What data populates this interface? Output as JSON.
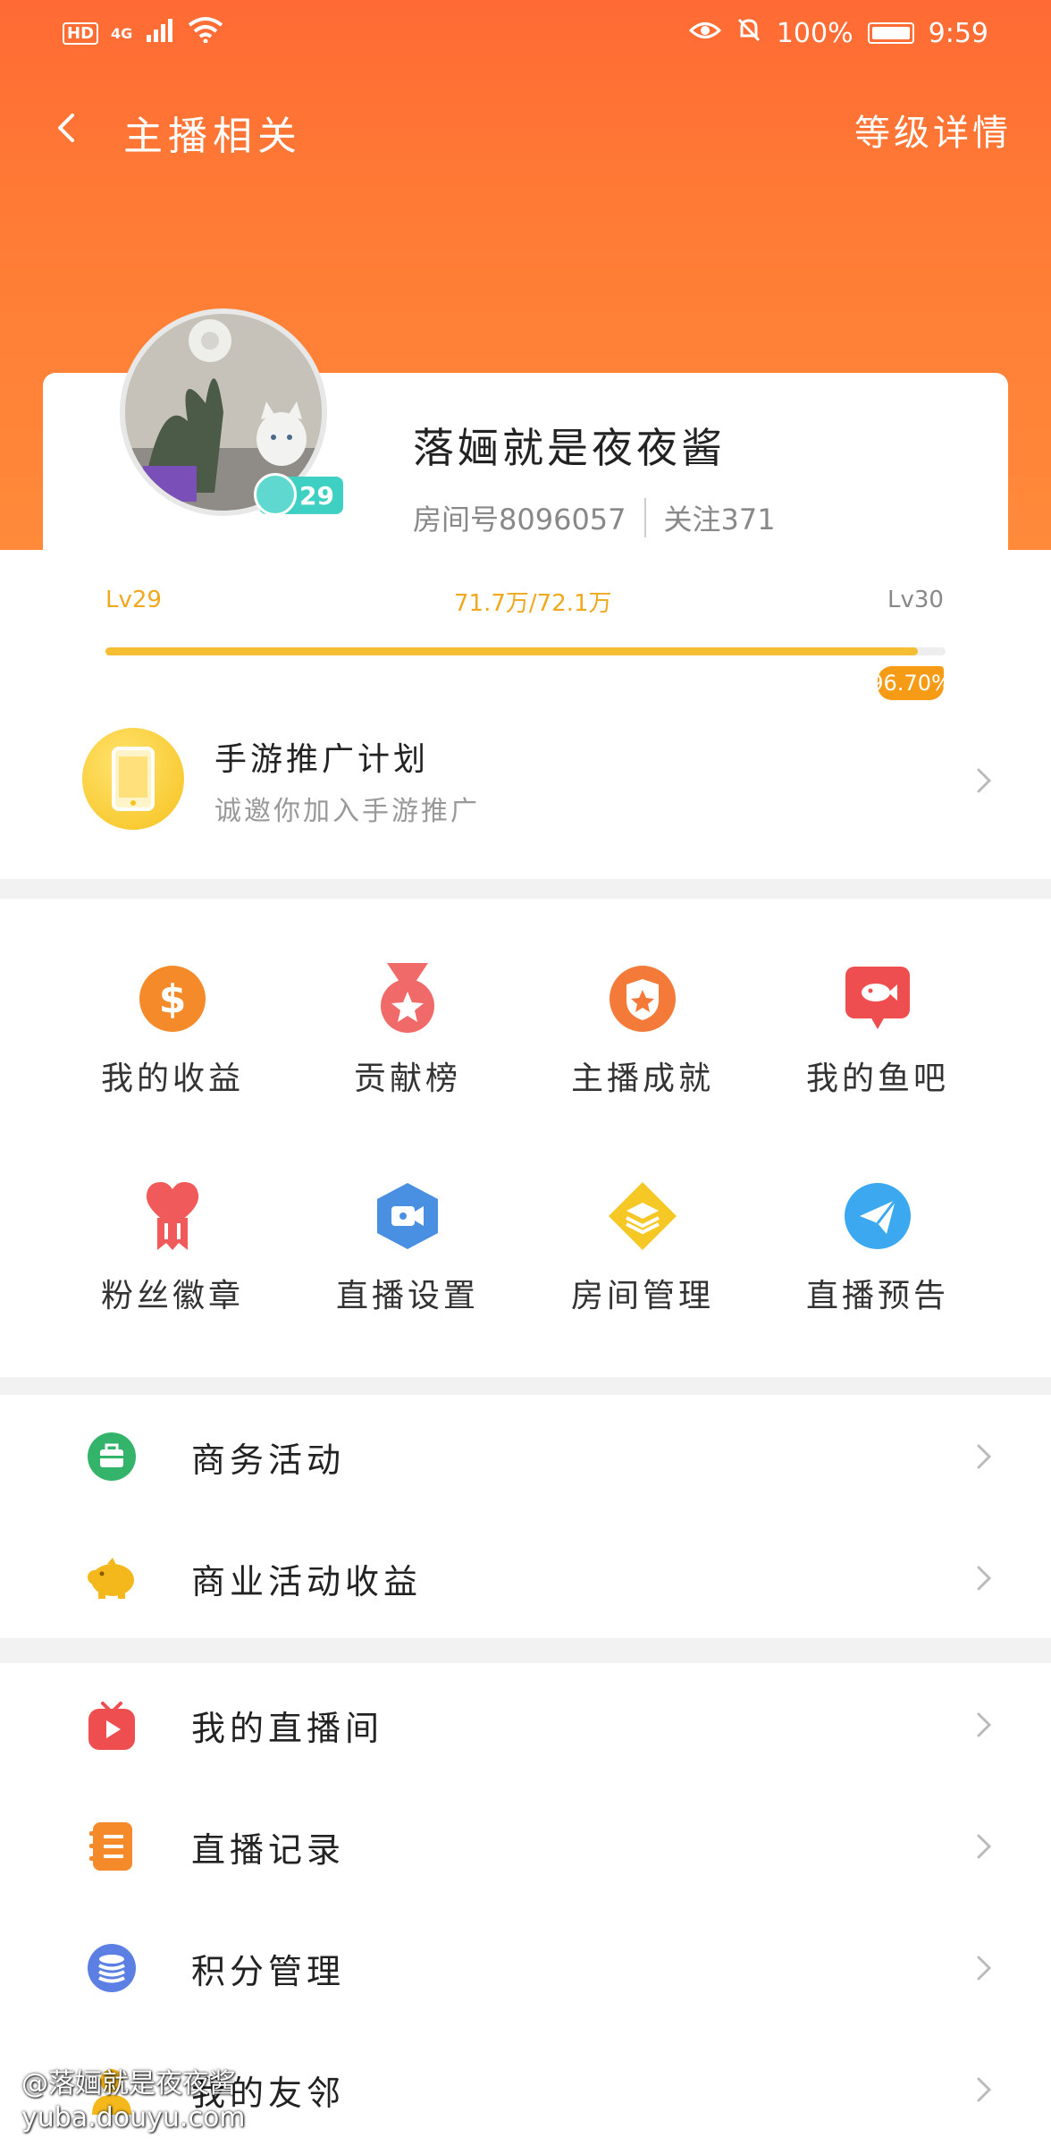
{
  "status_bar": {
    "hd": "HD",
    "network": "4G",
    "battery": "100%",
    "time": "9:59"
  },
  "nav": {
    "title": "主播相关",
    "right_action": "等级详情"
  },
  "profile": {
    "name": "落婳就是夜夜酱",
    "room_no": "房间号8096057",
    "follow": "关注371",
    "badge_level": "29"
  },
  "level": {
    "current": "Lv29",
    "progress_text": "71.7万/72.1万",
    "next": "Lv30",
    "percent_label": "96.70%",
    "percent": 96.7
  },
  "promo": {
    "title": "手游推广计划",
    "subtitle": "诚邀你加入手游推广"
  },
  "grid": [
    {
      "label": "我的收益",
      "icon": "dollar-coin-icon",
      "color": "#f58a2a"
    },
    {
      "label": "贡献榜",
      "icon": "medal-icon",
      "color": "#f06a6a"
    },
    {
      "label": "主播成就",
      "icon": "star-shield-icon",
      "color": "#f47a3a"
    },
    {
      "label": "我的鱼吧",
      "icon": "fish-chat-icon",
      "color": "#ef4e50"
    },
    {
      "label": "粉丝徽章",
      "icon": "heart-badge-icon",
      "color": "#f05a5a"
    },
    {
      "label": "直播设置",
      "icon": "camera-hexagon-icon",
      "color": "#4a90e2"
    },
    {
      "label": "房间管理",
      "icon": "layers-diamond-icon",
      "color": "#f5c825"
    },
    {
      "label": "直播预告",
      "icon": "paper-plane-icon",
      "color": "#3ca8f0"
    }
  ],
  "list1": [
    {
      "label": "商务活动",
      "icon": "briefcase-icon",
      "color": "#34b36b"
    },
    {
      "label": "商业活动收益",
      "icon": "piggy-bank-icon",
      "color": "#f5b81c"
    }
  ],
  "list2": [
    {
      "label": "我的直播间",
      "icon": "tv-play-icon",
      "color": "#ef4e50"
    },
    {
      "label": "直播记录",
      "icon": "notebook-icon",
      "color": "#f58a2a"
    },
    {
      "label": "积分管理",
      "icon": "coin-stack-icon",
      "color": "#5b7fe3"
    },
    {
      "label": "我的友邻",
      "icon": "friend-icon",
      "color": "#f5b81c"
    }
  ],
  "watermark": {
    "line1": "@落婳就是夜夜酱",
    "line2": "yuba.douyu.com"
  }
}
